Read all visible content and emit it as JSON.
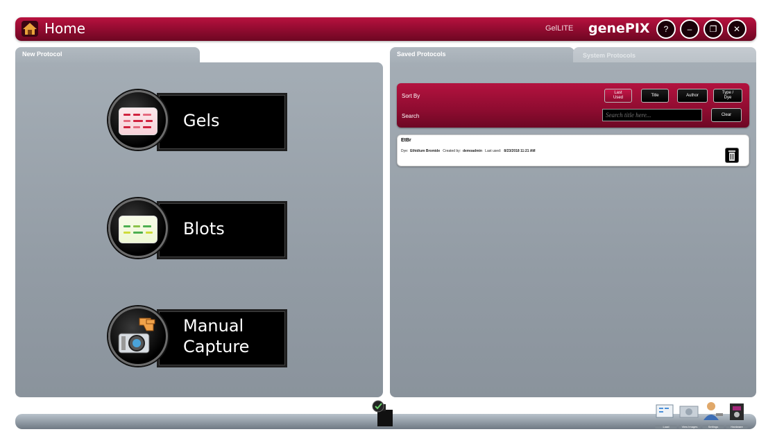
{
  "header": {
    "title": "Home",
    "edition": "GelLITE",
    "brand": "genePIX",
    "buttons": [
      {
        "name": "help-button",
        "glyph": "?"
      },
      {
        "name": "minimize-button",
        "glyph": "–"
      },
      {
        "name": "restore-button",
        "glyph": "❐"
      },
      {
        "name": "close-button",
        "glyph": "✕"
      }
    ]
  },
  "left_panel": {
    "tab_label": "New Protocol",
    "buttons": [
      {
        "label_line1": "Gels",
        "label_line2": ""
      },
      {
        "label_line1": "Blots",
        "label_line2": ""
      },
      {
        "label_line1": "Manual",
        "label_line2": "Capture"
      }
    ]
  },
  "right_panel": {
    "tabs": {
      "saved": "Saved Protocols",
      "system": "System Protocols"
    },
    "sort_label": "Sort By",
    "search_label": "Search",
    "sort_buttons": {
      "last_used_line1": "Last",
      "last_used_line2": "Used",
      "title": "Title",
      "author": "Author",
      "type_line1": "Type /",
      "type_line2": "Dye"
    },
    "search_placeholder": "Search title here...",
    "clear_label": "Clear",
    "records": [
      {
        "name": "EtBr",
        "dye_label": "Dye:",
        "dye": "Ethidium Bromide",
        "created_label": "Created by:",
        "created_by": "demoadmin",
        "last_used_label": "Last used:",
        "last_used": "8/23/2018 11:21 AM"
      }
    ]
  },
  "toolbar": {
    "tools": [
      {
        "name": "load-tool",
        "label": "Load"
      },
      {
        "name": "view-images-tool",
        "label": "View Images"
      },
      {
        "name": "settings-tool",
        "label": "Settings"
      },
      {
        "name": "hardware-tool",
        "label": "Hardware"
      }
    ]
  },
  "colors": {
    "accent": "#9a0c33",
    "panel": "#9aa3ab",
    "button_black": "#000000"
  }
}
